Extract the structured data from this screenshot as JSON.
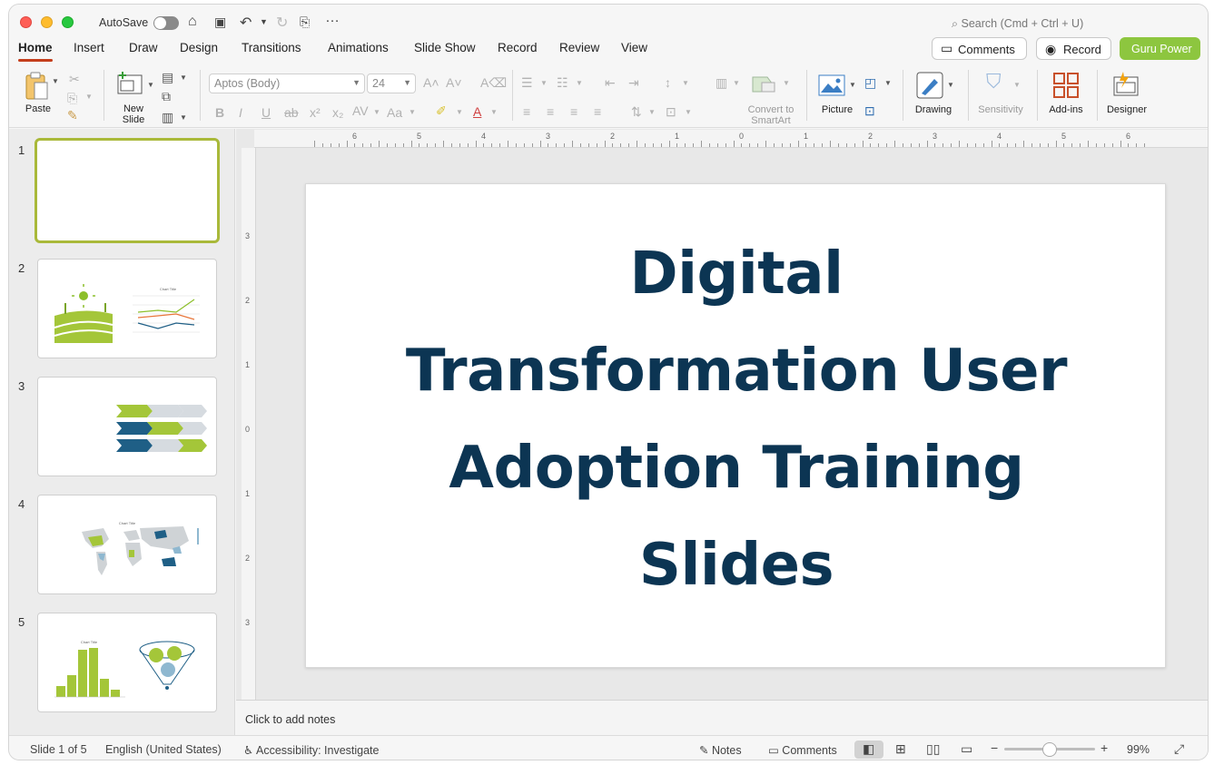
{
  "titlebar": {
    "autosave_label": "AutoSave",
    "search_placeholder": "Search (Cmd + Ctrl + U)"
  },
  "tabs": [
    "Home",
    "Insert",
    "Draw",
    "Design",
    "Transitions",
    "Animations",
    "Slide Show",
    "Record",
    "Review",
    "View"
  ],
  "header_buttons": {
    "comments": "Comments",
    "record": "Record",
    "guru": "Guru Power"
  },
  "ribbon": {
    "paste": "Paste",
    "new_slide": "New Slide",
    "font_name": "Aptos (Body)",
    "font_size": "24",
    "convert_line1": "Convert to",
    "convert_line2": "SmartArt",
    "picture": "Picture",
    "drawing": "Drawing",
    "sensitivity": "Sensitivity",
    "addins": "Add-ins",
    "designer": "Designer"
  },
  "thumbnails": [
    {
      "num": "1"
    },
    {
      "num": "2",
      "chart_title": "Chart Title"
    },
    {
      "num": "3"
    },
    {
      "num": "4",
      "chart_title": "Chart Title"
    },
    {
      "num": "5",
      "chart_title": "Chart Title"
    }
  ],
  "slide": {
    "title_lines": [
      "Digital",
      "Transformation User",
      "Adoption Training",
      "Slides"
    ]
  },
  "notes_placeholder": "Click to add notes",
  "status": {
    "slide_info": "Slide 1 of 5",
    "language": "English (United States)",
    "accessibility": "Accessibility: Investigate",
    "notes": "Notes",
    "comments": "Comments",
    "zoom": "99%"
  },
  "ruler": {
    "h_labels": [
      "6",
      "5",
      "4",
      "3",
      "2",
      "1",
      "0",
      "1",
      "2",
      "3",
      "4",
      "5",
      "6"
    ],
    "v_labels": [
      "3",
      "2",
      "1",
      "0",
      "1",
      "2",
      "3"
    ]
  },
  "colors": {
    "accent_green": "#8dc63f",
    "title_navy": "#0c3553",
    "tab_underline": "#c43e1c"
  }
}
